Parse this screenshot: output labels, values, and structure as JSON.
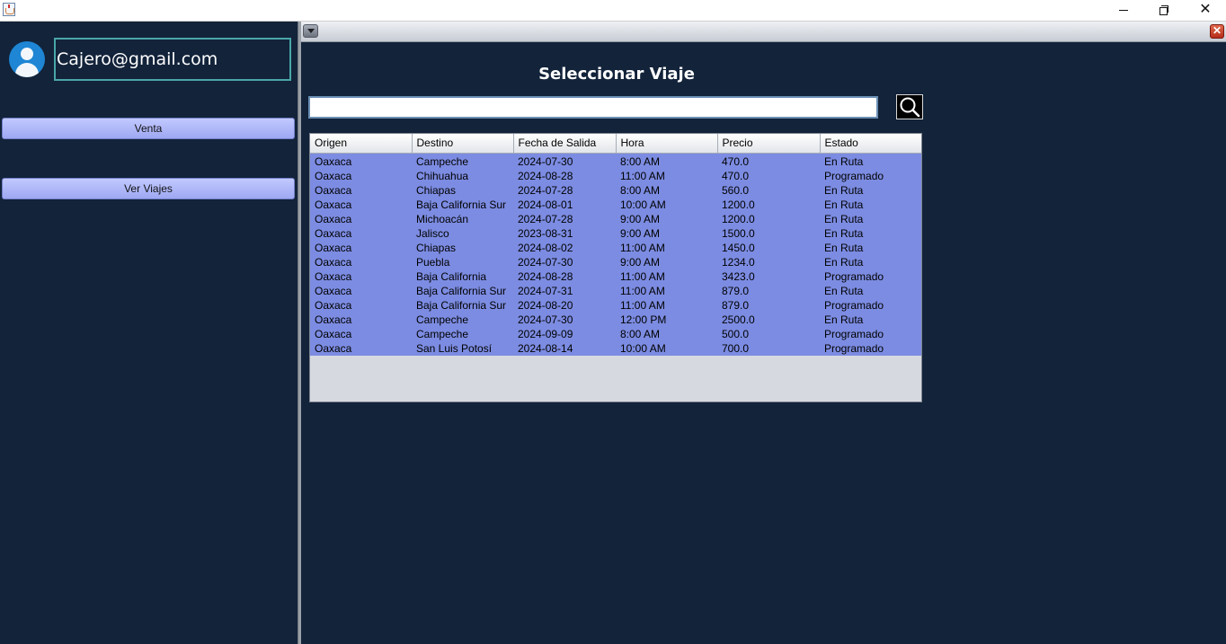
{
  "window": {
    "icons": {
      "app": "java-cup-icon",
      "minimize": "minimize-icon",
      "maximize": "restore-icon",
      "close": "close-icon"
    }
  },
  "sidebar": {
    "user_email": "Cajero@gmail.com",
    "avatar_icon": "user-avatar-icon",
    "buttons": {
      "venta": "Venta",
      "ver_viajes": "Ver Viajes"
    },
    "button_color": "#9ea8f2"
  },
  "frame": {
    "title": "Seleccionar Viaje",
    "search": {
      "value": "",
      "placeholder": ""
    },
    "search_icon": "magnifier-icon",
    "menu_icon": "chevron-down-icon",
    "close_icon": "close-icon"
  },
  "table": {
    "columns": [
      "Origen",
      "Destino",
      "Fecha de Salida",
      "Hora",
      "Precio",
      "Estado"
    ],
    "rows": [
      [
        "Oaxaca",
        "Campeche",
        "2024-07-30",
        "8:00 AM",
        "470.0",
        "En Ruta"
      ],
      [
        "Oaxaca",
        "Chihuahua",
        "2024-08-28",
        "11:00 AM",
        "470.0",
        "Programado"
      ],
      [
        "Oaxaca",
        "Chiapas",
        "2024-07-28",
        "8:00 AM",
        "560.0",
        "En Ruta"
      ],
      [
        "Oaxaca",
        "Baja California Sur",
        "2024-08-01",
        "10:00 AM",
        "1200.0",
        "En Ruta"
      ],
      [
        "Oaxaca",
        "Michoacán",
        "2024-07-28",
        "9:00 AM",
        "1200.0",
        "En Ruta"
      ],
      [
        "Oaxaca",
        "Jalisco",
        "2023-08-31",
        "9:00 AM",
        "1500.0",
        "En Ruta"
      ],
      [
        "Oaxaca",
        "Chiapas",
        "2024-08-02",
        "11:00 AM",
        "1450.0",
        "En Ruta"
      ],
      [
        "Oaxaca",
        "Puebla",
        "2024-07-30",
        "9:00 AM",
        "1234.0",
        "En Ruta"
      ],
      [
        "Oaxaca",
        "Baja California",
        "2024-08-28",
        "11:00 AM",
        "3423.0",
        "Programado"
      ],
      [
        "Oaxaca",
        "Baja California Sur",
        "2024-07-31",
        "11:00 AM",
        "879.0",
        "En Ruta"
      ],
      [
        "Oaxaca",
        "Baja California Sur",
        "2024-08-20",
        "11:00 AM",
        "879.0",
        "Programado"
      ],
      [
        "Oaxaca",
        "Campeche",
        "2024-07-30",
        "12:00 PM",
        "2500.0",
        "En Ruta"
      ],
      [
        "Oaxaca",
        "Campeche",
        "2024-09-09",
        "8:00 AM",
        "500.0",
        "Programado"
      ],
      [
        "Oaxaca",
        "San Luis Potosí",
        "2024-08-14",
        "10:00 AM",
        "700.0",
        "Programado"
      ]
    ],
    "selection_color": "#7c8ce2"
  }
}
